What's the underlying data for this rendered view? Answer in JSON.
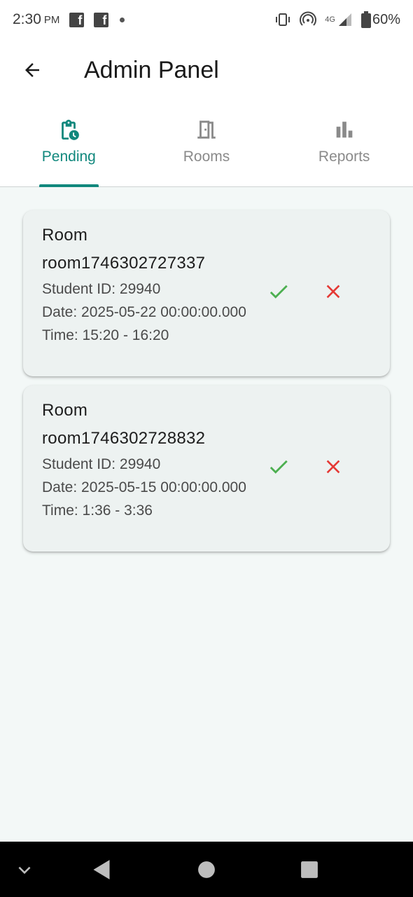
{
  "status_bar": {
    "time": "2:30",
    "ampm": "PM",
    "network": "4G",
    "battery": "60%"
  },
  "app_bar": {
    "title": "Admin Panel"
  },
  "tabs": [
    {
      "label": "Pending",
      "icon": "pending-clipboard-icon",
      "active": true
    },
    {
      "label": "Rooms",
      "icon": "door-icon",
      "active": false
    },
    {
      "label": "Reports",
      "icon": "bar-chart-icon",
      "active": false
    }
  ],
  "requests": [
    {
      "title": "Room room1746302727337",
      "student_id": "Student ID: 29940",
      "date": "Date: 2025-05-22 00:00:00.000",
      "time": "Time: 15:20 - 16:20"
    },
    {
      "title": "Room room1746302728832",
      "student_id": "Student ID: 29940",
      "date": "Date: 2025-05-15 00:00:00.000",
      "time": "Time: 1:36 - 3:36"
    }
  ],
  "colors": {
    "accent": "#11887d",
    "approve": "#4caf50",
    "reject": "#e53935",
    "background": "#f3f8f7",
    "card": "#edf2f1"
  }
}
